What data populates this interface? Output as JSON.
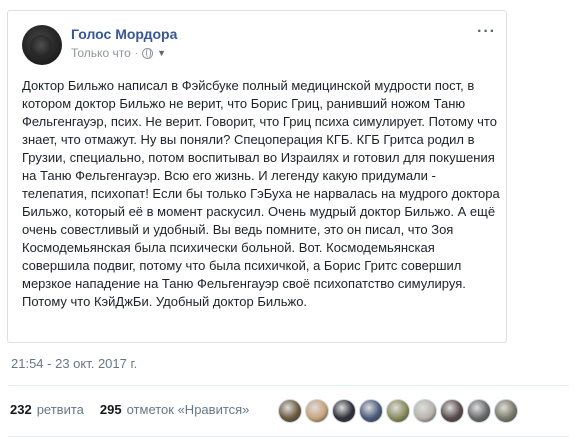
{
  "post": {
    "author": "Голос Мордора",
    "time_label": "Только что",
    "dot": "·",
    "more_label": "···",
    "text": "Доктор Бильжо написал в Фэйсбуке полный медицинской мудрости пост, в котором доктор Бильжо не верит, что Борис Гриц, ранивший ножом Таню Фельгенгауэр, псих. Не верит. Говорит, что Гриц психа симулирует. Потому что знает, что отмажут. Ну вы поняли? Спецоперация КГБ. КГБ Гритса родил в Грузии, специально, потом воспитывал во Израилях и готовил для покушения на Таню Фельгенгауэр. Всю его жизнь. И легенду какую придумали - телепатия, психопат! Если бы только ГэБуха не нарвалась на мудрого доктора Бильжо, который её в момент раскусил. Очень мудрый доктор Бильжо. А ещё очень совестливый и удобный. Вы ведь помните, это он писал, что Зоя Космодемьянская была психически больной. Вот. Космодемьянская совершила подвиг, потому что была психичкой, а Борис Гритс совершил мерзкое нападение на Таню Фельгенгауэр своё психопатство симулируя. Потому что КэйДжБи. Удобный доктор Бильжо."
  },
  "tweet": {
    "timestamp": "21:54 - 23 окт. 2017 г.",
    "retweets_count": "232",
    "retweets_label": "ретвита",
    "likes_count": "295",
    "likes_label": "отметок «Нравится»"
  },
  "liker_avatars": [
    {
      "name": "liker-avatar-1",
      "color": "#6b5a3e"
    },
    {
      "name": "liker-avatar-2",
      "color": "#c9a27a"
    },
    {
      "name": "liker-avatar-3",
      "color": "#2f2f3a"
    },
    {
      "name": "liker-avatar-4",
      "color": "#4a5a7a"
    },
    {
      "name": "liker-avatar-5",
      "color": "#8a8a5a"
    },
    {
      "name": "liker-avatar-6",
      "color": "#b8b4ac"
    },
    {
      "name": "liker-avatar-7",
      "color": "#5a4a4a"
    },
    {
      "name": "liker-avatar-8",
      "color": "#6a6a6a"
    },
    {
      "name": "liker-avatar-9",
      "color": "#7a7a6a"
    }
  ],
  "colors": {
    "author_link": "#365899",
    "meta_gray": "#90949c",
    "tweet_gray": "#657786"
  }
}
